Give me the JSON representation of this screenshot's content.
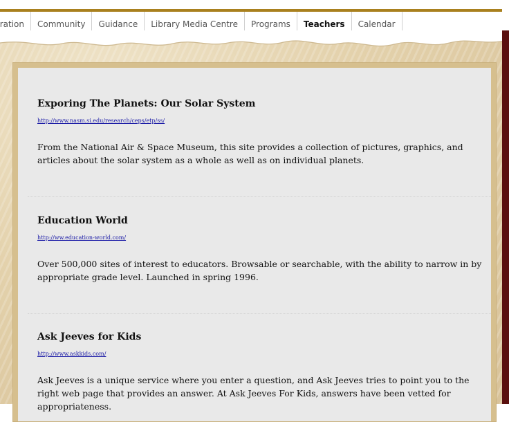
{
  "nav": {
    "items": [
      {
        "label": "tration"
      },
      {
        "label": "Community"
      },
      {
        "label": "Guidance"
      },
      {
        "label": "Library Media Centre"
      },
      {
        "label": "Programs"
      },
      {
        "label": "Teachers",
        "active": true
      },
      {
        "label": "Calendar"
      }
    ]
  },
  "entries": [
    {
      "title": "Exporing The Planets: Our Solar System",
      "url": "http://www.nasm.si.edu/research/ceps/etp/ss/",
      "description": "From the National Air & Space Museum, this site provides a collection of pictures, graphics, and articles about the solar system as a whole as well as on individual planets."
    },
    {
      "title": "Education World",
      "url": "http://ww.education-world.com/",
      "description": "Over 500,000 sites of interest to educators. Browsable or searchable, with the ability to narrow in by appropriate grade level. Launched in spring 1996."
    },
    {
      "title": "Ask Jeeves for Kids",
      "url": "http://www.askkids.com/",
      "description": "Ask Jeeves is a unique service where you enter a question, and Ask Jeeves tries to point you to the right web page that provides an answer. At Ask Jeeves For Kids, answers have been vetted for appropriateness."
    }
  ],
  "colors": {
    "accent_rule": "#a9801e",
    "link": "#1a1aa6",
    "panel": "#e9e9e9",
    "parchment": "#e3d1ab",
    "right_strip": "#5a0f0f"
  }
}
